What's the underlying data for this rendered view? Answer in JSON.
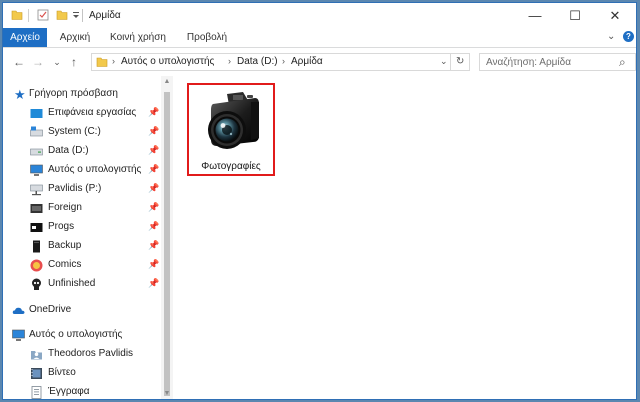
{
  "window": {
    "title": "Αρμίδα",
    "controls": {
      "minimize": "—",
      "maximize": "☐",
      "close": "✕"
    }
  },
  "ribbon": {
    "tabs": [
      {
        "label": "Αρχείο",
        "active": true
      },
      {
        "label": "Αρχική"
      },
      {
        "label": "Κοινή χρήση"
      },
      {
        "label": "Προβολή"
      }
    ],
    "expand_icon": "⌄",
    "help_icon": "?"
  },
  "address": {
    "back": "←",
    "forward": "→",
    "recent": "⌄",
    "up": "↑",
    "crumbs": [
      "Αυτός ο υπολογιστής",
      "Data (D:)",
      "Αρμίδα"
    ],
    "dropdown": "⌄",
    "refresh": "↻"
  },
  "search": {
    "placeholder": "Αναζήτηση: Αρμίδα",
    "icon": "⌕"
  },
  "navpane": {
    "quick_access": {
      "label": "Γρήγορη πρόσβαση",
      "items": [
        {
          "label": "Επιφάνεια εργασίας",
          "pinned": true
        },
        {
          "label": "System (C:)",
          "pinned": true
        },
        {
          "label": "Data (D:)",
          "pinned": true
        },
        {
          "label": "Αυτός ο υπολογιστής",
          "pinned": true
        },
        {
          "label": "Pavlidis (P:)",
          "pinned": true
        },
        {
          "label": "Foreign",
          "pinned": true
        },
        {
          "label": "Progs",
          "pinned": true
        },
        {
          "label": "Backup",
          "pinned": true
        },
        {
          "label": "Comics",
          "pinned": true
        },
        {
          "label": "Unfinished",
          "pinned": true
        }
      ]
    },
    "onedrive": {
      "label": "OneDrive"
    },
    "this_pc": {
      "label": "Αυτός ο υπολογιστής",
      "items": [
        {
          "label": "Theodoros Pavlidis"
        },
        {
          "label": "Βίντεο"
        },
        {
          "label": "Έγγραφα"
        }
      ]
    }
  },
  "content": {
    "items": [
      {
        "label": "Φωτογραφίες",
        "type": "folder"
      }
    ]
  },
  "colors": {
    "accent": "#1e6ec4",
    "selection_border": "#e11b1b",
    "folder": "#f2c94c"
  }
}
